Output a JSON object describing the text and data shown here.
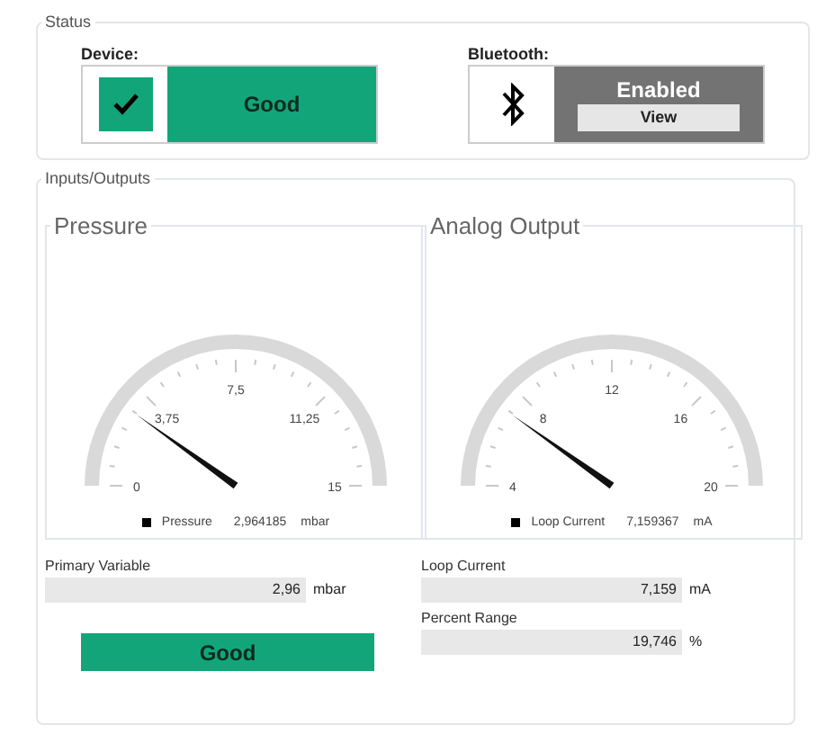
{
  "status": {
    "title": "Status",
    "device": {
      "label": "Device:",
      "checked": true,
      "state": "Good"
    },
    "bluetooth": {
      "label": "Bluetooth:",
      "state": "Enabled",
      "button": "View"
    }
  },
  "io": {
    "title": "Inputs/Outputs",
    "gauges": [
      {
        "title": "Pressure",
        "ticks": [
          "0",
          "3,75",
          "7,5",
          "11,25",
          "15"
        ],
        "level": 0.198,
        "legend": {
          "name": "Pressure",
          "value": "2,964185",
          "unit": "mbar"
        }
      },
      {
        "title": "Analog Output",
        "ticks": [
          "4",
          "8",
          "12",
          "16",
          "20"
        ],
        "level": 0.197,
        "legend": {
          "name": "Loop Current",
          "value": "7,159367",
          "unit": "mA"
        }
      }
    ],
    "left_fields": [
      {
        "label": "Primary Variable",
        "value": "2,96",
        "unit": "mbar"
      }
    ],
    "status_button": "Good",
    "right_fields": [
      {
        "label": "Loop Current",
        "value": "7,159",
        "unit": "mA"
      },
      {
        "label": "Percent Range",
        "value": "19,746",
        "unit": "%"
      }
    ]
  }
}
